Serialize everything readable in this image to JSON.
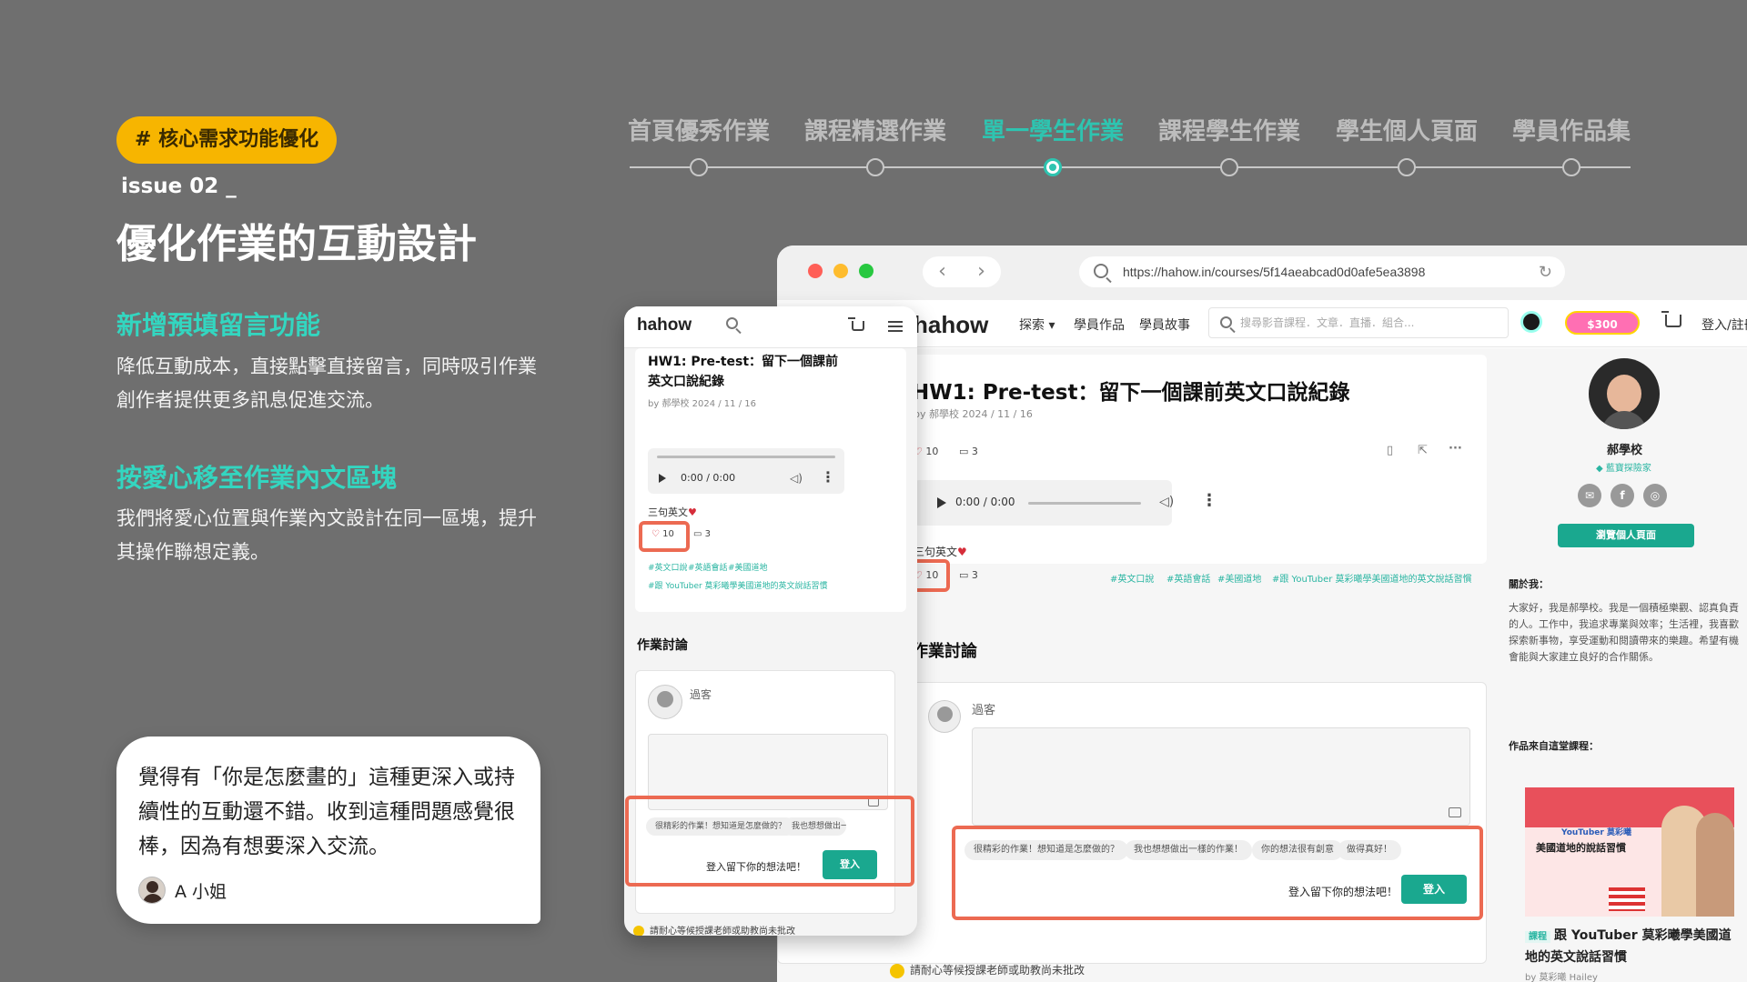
{
  "slide": {
    "badge": "# 核心需求功能優化",
    "issue": "issue 02 _",
    "headline": "優化作業的互動設計",
    "features": [
      {
        "title": "新增預填留言功能",
        "desc": "降低互動成本，直接點擊直接留言，同時吸引作業創作者提供更多訊息促進交流。"
      },
      {
        "title": "按愛心移至作業內文區塊",
        "desc": "我們將愛心位置與作業內文設計在同一區塊，提升其操作聯想定義。"
      }
    ],
    "quote": {
      "text": "覺得有「你是怎麼畫的」這種更深入或持續性的互動還不錯。收到這種問題感覺很棒，因為有想要深入交流。",
      "user": "A 小姐"
    }
  },
  "timeline": {
    "items": [
      "首頁優秀作業",
      "課程精選作業",
      "單一學生作業",
      "課程學生作業",
      "學生個人頁面",
      "學員作品集"
    ],
    "active": "單一學生作業"
  },
  "colors": {
    "accent": "#2ec4b0",
    "badge": "#f7b500",
    "highlight": "#ec6a52",
    "button": "#1aa88f"
  },
  "browser": {
    "url": "https://hahow.in/courses/5f14aeabcad0d0afe5ea3898",
    "logo": "hahow",
    "nav": {
      "explore": "探索 ▾",
      "works": "學員作品",
      "stories": "學員故事",
      "search_placeholder": "搜尋影音課程．文章．直播．組合...",
      "promo": "$300",
      "login": "登入/註冊"
    },
    "post": {
      "title": "HW1: Pre-test：留下一個課前英文口說紀錄",
      "meta": "by 郝學校  2024 / 11 / 16",
      "time": "0:00 / 0:00",
      "caption": "三句英文",
      "likes": "10",
      "comments": "3",
      "tags": [
        "#英文口說",
        "#英語會話",
        "#美國道地",
        "#跟 YouTuber 莫彩曦學美國道地的英文說話習慣"
      ]
    },
    "discussion": {
      "heading": "作業討論",
      "guest": "過客",
      "chips": [
        "很精彩的作業！想知道是怎麼做的？",
        "我也想想做出一樣的作業！",
        "你的想法很有創意",
        "做得真好！"
      ],
      "cta": "登入留下你的想法吧！",
      "login_button": "登入"
    },
    "notice": "請耐心等候授課老師或助教尚未批改",
    "profile": {
      "name": "郝學校",
      "role": "藍寶探險家",
      "view_button": "瀏覽個人頁面",
      "about_label": "關於我：",
      "about": "大家好，我是郝學校。我是一個積極樂觀、認真負責的人。工作中，我追求專業與效率；生活裡，我喜歡探索新事物，享受運動和閱讀帶來的樂趣。希望有機會能與大家建立良好的合作關係。",
      "from_course_label": "作品來自這堂課程：",
      "course_badge": "課程",
      "course_title": "跟 YouTuber 莫彩曦學美國道地的英文說話習慣",
      "course_image_title": "美國道地的說話習慣",
      "course_image_label": "YouTuber 莫彩曦",
      "course_author": "by 莫彩曦 Hailey"
    }
  },
  "mobile": {
    "logo": "hahow",
    "post": {
      "title": "HW1: Pre-test：留下一個課前英文口說紀錄",
      "meta": "by 郝學校  2024 / 11 / 16",
      "time": "0:00 / 0:00",
      "caption": "三句英文",
      "likes": "10",
      "comments": "3",
      "tags": [
        "#英文口說",
        "#英語會話",
        "#美國道地",
        "#跟 YouTuber 莫彩曦學美國道地的英文說話習慣"
      ]
    },
    "discussion": {
      "heading": "作業討論",
      "guest": "過客",
      "chips": [
        "很精彩的作業！想知道是怎麼做的？",
        "我也想想做出一"
      ],
      "cta": "登入留下你的想法吧！",
      "login_button": "登入"
    },
    "notice": "請耐心等候授課老師或助教尚未批改"
  }
}
